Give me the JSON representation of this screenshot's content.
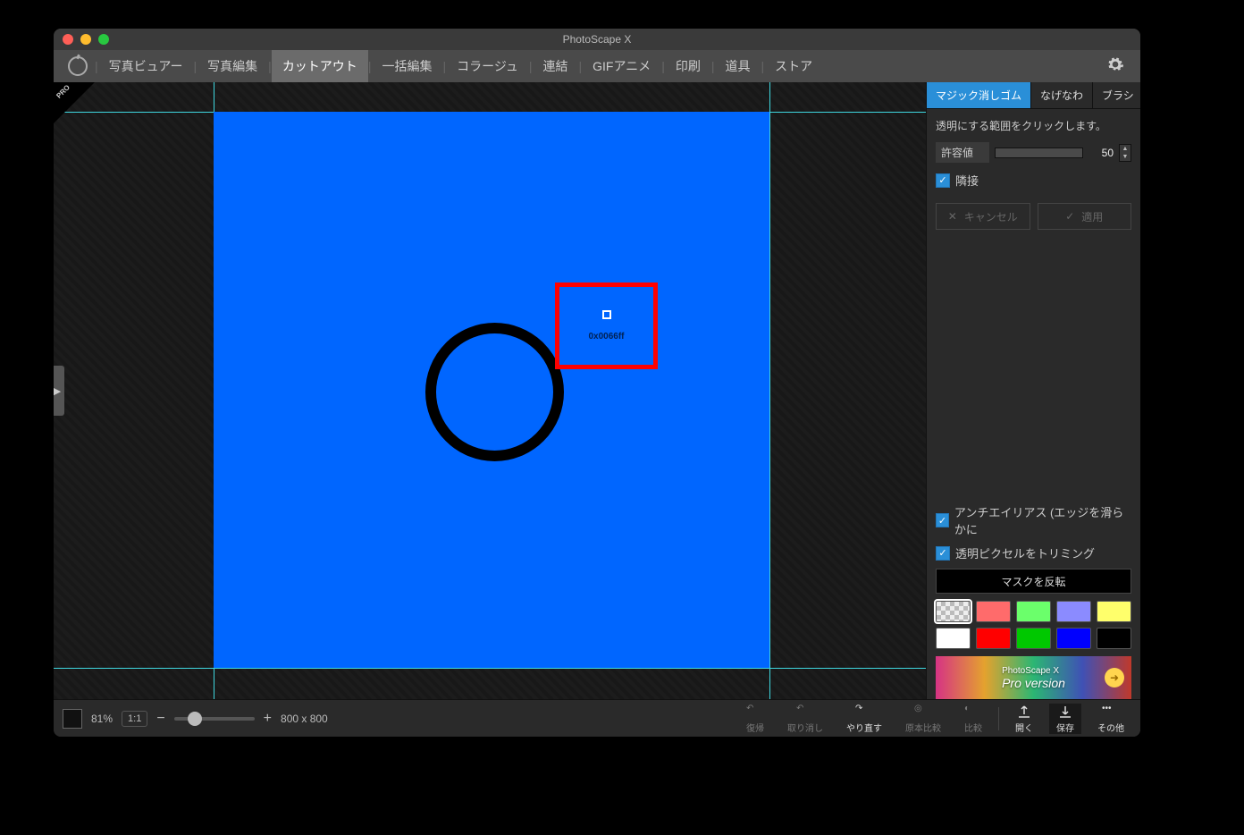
{
  "title": "PhotoScape X",
  "tabs": [
    "写真ビュアー",
    "写真編集",
    "カットアウト",
    "一括編集",
    "コラージュ",
    "連結",
    "GIFアニメ",
    "印刷",
    "道具",
    "ストア"
  ],
  "active_tab_index": 2,
  "pro_badge": "PRO",
  "sidepanel": {
    "tooltabs": [
      "マジック消しゴム",
      "なげなわ",
      "ブラシ"
    ],
    "active_tooltab": 0,
    "hint": "透明にする範囲をクリックします。",
    "tolerance_label": "許容値",
    "tolerance_value": "50",
    "adjacent_label": "隣接",
    "cancel_label": "キャンセル",
    "apply_label": "適用",
    "antialias_label": "アンチエイリアス (エッジを滑らかに",
    "trim_label": "透明ピクセルをトリミング",
    "invert_label": "マスクを反転",
    "swatch_colors": [
      "checker",
      "#ff6b6b",
      "#6bff6b",
      "#8b8bff",
      "#ffff6b",
      "#ffffff",
      "#ff0000",
      "#00c800",
      "#0000ff",
      "#000000"
    ]
  },
  "eyedropper_code": "0x0066ff",
  "promo": {
    "line1": "PhotoScape X",
    "line2": "Pro version"
  },
  "bottombar": {
    "zoom_pct": "81%",
    "ratio_btn": "1:1",
    "dimensions": "800 x 800",
    "actions": {
      "restore": "復帰",
      "undo": "取り消し",
      "redo": "やり直す",
      "orig": "原本比較",
      "compare": "比較",
      "open": "開く",
      "save": "保存",
      "more": "その他"
    }
  }
}
